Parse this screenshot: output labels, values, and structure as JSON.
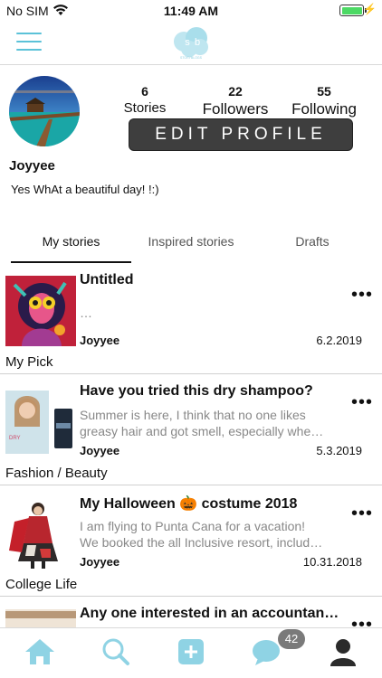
{
  "status_bar": {
    "carrier": "No SIM",
    "time": "11:49 AM"
  },
  "header": {
    "logo_text": "STORYBLOGS",
    "logo_letters": "sb"
  },
  "profile": {
    "stats": [
      {
        "value": "6",
        "label": "Stories"
      },
      {
        "value": "22",
        "label": "Followers"
      },
      {
        "value": "55",
        "label": "Following"
      }
    ],
    "edit_button": "EDIT PROFILE",
    "username": "Joyyee",
    "bio": "Yes WhAt a beautiful day! !:)"
  },
  "tabs": [
    {
      "label": "My stories",
      "active": true
    },
    {
      "label": "Inspired stories",
      "active": false
    },
    {
      "label": "Drafts",
      "active": false
    }
  ],
  "stories": [
    {
      "title": "Untitled",
      "excerpt": [
        "…",
        ""
      ],
      "author": "Joyyee",
      "date": "6.2.2019",
      "category": "My Pick"
    },
    {
      "title": "Have you tried this dry shampoo?",
      "excerpt": [
        "Summer is here, I think that no one likes",
        "greasy hair and got smell, especially whe…"
      ],
      "author": "Joyyee",
      "date": "5.3.2019",
      "category": "Fashion / Beauty"
    },
    {
      "title": "My Halloween 🎃 costume 2018",
      "excerpt": [
        "I am flying to Punta Cana for a vacation!",
        "We booked the all Inclusive resort, includ…"
      ],
      "author": "Joyyee",
      "date": "10.31.2018",
      "category": "College Life"
    },
    {
      "title": "Any one interested in an accountan…",
      "excerpt": [
        "",
        ""
      ],
      "author": "",
      "date": "",
      "category": ""
    }
  ],
  "more_glyph": "•••",
  "tab_bar": {
    "messages_badge": "42"
  },
  "colors": {
    "accent": "#5bc2d8",
    "button": "#3e3e3e",
    "battery": "#4cd964"
  },
  "icons": [
    "menu-icon",
    "home-icon",
    "search-icon",
    "add-icon",
    "chat-icon",
    "profile-icon",
    "wifi-icon",
    "battery-icon"
  ]
}
